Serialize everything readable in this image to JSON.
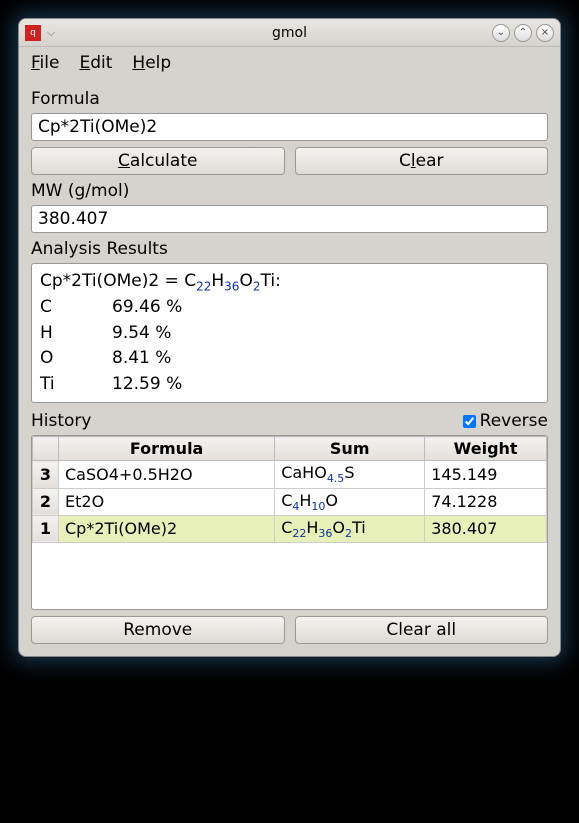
{
  "window": {
    "title": "gmol"
  },
  "menu": {
    "file": "File",
    "edit": "Edit",
    "help": "Help"
  },
  "formula": {
    "label": "Formula",
    "value": "Cp*2Ti(OMe)2",
    "calc": "Calculate",
    "clear": "Clear"
  },
  "mw": {
    "label": "MW (g/mol)",
    "value": "380.407"
  },
  "analysis": {
    "label": "Analysis Results",
    "formula_plain": "Cp*2Ti(OMe)2",
    "sum_html": "C<sub>22</sub>H<sub>36</sub>O<sub>2</sub>Ti",
    "rows": [
      {
        "el": "C",
        "pct": "69.46 %"
      },
      {
        "el": "H",
        "pct": "9.54 %"
      },
      {
        "el": "O",
        "pct": "8.41 %"
      },
      {
        "el": "Ti",
        "pct": "12.59 %"
      }
    ]
  },
  "history": {
    "label": "History",
    "reverse_label": "Reverse",
    "reverse_checked": true,
    "cols": {
      "formula": "Formula",
      "sum": "Sum",
      "weight": "Weight"
    },
    "rows": [
      {
        "n": "3",
        "formula": "CaSO4+0.5H2O",
        "sum_html": "CaHO<sub>4.5</sub>S",
        "weight": "145.149",
        "selected": false
      },
      {
        "n": "2",
        "formula": "Et2O",
        "sum_html": "C<sub>4</sub>H<sub>10</sub>O",
        "weight": "74.1228",
        "selected": false
      },
      {
        "n": "1",
        "formula": "Cp*2Ti(OMe)2",
        "sum_html": "C<sub>22</sub>H<sub>36</sub>O<sub>2</sub>Ti",
        "weight": "380.407",
        "selected": true
      }
    ],
    "remove": "Remove",
    "clearall": "Clear all"
  }
}
